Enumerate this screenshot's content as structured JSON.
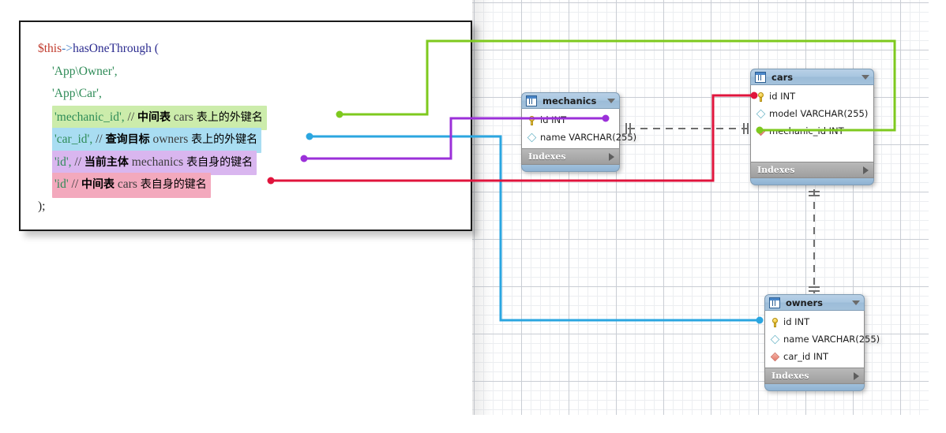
{
  "code_panel": {
    "lines": [
      {
        "id": "line-1",
        "indent": 0,
        "highlight": "none",
        "segments": [
          {
            "cls": "tok-var",
            "text": "$this"
          },
          {
            "cls": "tok-arrow",
            "text": "->"
          },
          {
            "cls": "tok-fn",
            "text": "hasOneThrough ("
          }
        ]
      },
      {
        "id": "line-2",
        "indent": 1,
        "highlight": "none",
        "segments": [
          {
            "cls": "tok-str",
            "text": "'App\\Owner',"
          }
        ]
      },
      {
        "id": "line-3",
        "indent": 1,
        "highlight": "none",
        "segments": [
          {
            "cls": "tok-str",
            "text": "'App\\Car',"
          }
        ]
      },
      {
        "id": "line-4",
        "indent": 1,
        "highlight": "green",
        "segments": [
          {
            "cls": "tok-str",
            "text": "'mechanic_id',"
          },
          {
            "cls": "tok-cmt",
            "text": " // "
          },
          {
            "cls": "cjk-b",
            "text": "中间表"
          },
          {
            "cls": "tok-cmt",
            "text": " cars "
          },
          {
            "cls": "cjk",
            "text": "表上的外键名"
          }
        ]
      },
      {
        "id": "line-5",
        "indent": 1,
        "highlight": "blue",
        "segments": [
          {
            "cls": "tok-str",
            "text": "'car_id',"
          },
          {
            "cls": "tok-cmt",
            "text": " // "
          },
          {
            "cls": "cjk-b",
            "text": "查询目标"
          },
          {
            "cls": "tok-cmt",
            "text": " owners "
          },
          {
            "cls": "cjk",
            "text": "表上的外键名"
          }
        ]
      },
      {
        "id": "line-6",
        "indent": 1,
        "highlight": "purple",
        "segments": [
          {
            "cls": "tok-str",
            "text": "'id',"
          },
          {
            "cls": "tok-cmt",
            "text": " // "
          },
          {
            "cls": "cjk-b",
            "text": "当前主体"
          },
          {
            "cls": "tok-cmt",
            "text": " mechanics "
          },
          {
            "cls": "cjk",
            "text": "表自身的键名"
          }
        ]
      },
      {
        "id": "line-7",
        "indent": 1,
        "highlight": "pink",
        "segments": [
          {
            "cls": "tok-str",
            "text": "'id'"
          },
          {
            "cls": "tok-cmt",
            "text": " // "
          },
          {
            "cls": "cjk-b",
            "text": "中间表"
          },
          {
            "cls": "tok-cmt",
            "text": " cars "
          },
          {
            "cls": "cjk",
            "text": "表自身的键名"
          }
        ]
      },
      {
        "id": "line-8",
        "indent": 0,
        "highlight": "none",
        "segments": [
          {
            "cls": "tok-plain",
            "text": ");"
          }
        ]
      }
    ],
    "highlight_colors": {
      "green": "#ccecab",
      "blue": "#a9ddf2",
      "purple": "#d9b6ef",
      "pink": "#f3a9bd"
    }
  },
  "connector_colors": {
    "green": "#7ec91e",
    "blue": "#2ba6e0",
    "purple": "#9b30d9",
    "red": "#e0143c",
    "relationship": "#6e6e6e"
  },
  "er_tables": [
    {
      "id": "mechanics",
      "name": "mechanics",
      "indexes_label": "Indexes",
      "columns": [
        {
          "icon": "primary-key-icon",
          "label": "id INT"
        },
        {
          "icon": "column-icon",
          "label": "name VARCHAR(255)"
        }
      ]
    },
    {
      "id": "cars",
      "name": "cars",
      "indexes_label": "Indexes",
      "columns": [
        {
          "icon": "primary-key-icon",
          "label": "id INT"
        },
        {
          "icon": "column-icon",
          "label": "model VARCHAR(255)"
        },
        {
          "icon": "foreign-key-icon",
          "label": "mechanic_id INT"
        }
      ]
    },
    {
      "id": "owners",
      "name": "owners",
      "indexes_label": "Indexes",
      "columns": [
        {
          "icon": "primary-key-icon",
          "label": "id INT"
        },
        {
          "icon": "column-icon",
          "label": "name VARCHAR(255)"
        },
        {
          "icon": "foreign-key-icon",
          "label": "car_id INT"
        }
      ]
    }
  ]
}
